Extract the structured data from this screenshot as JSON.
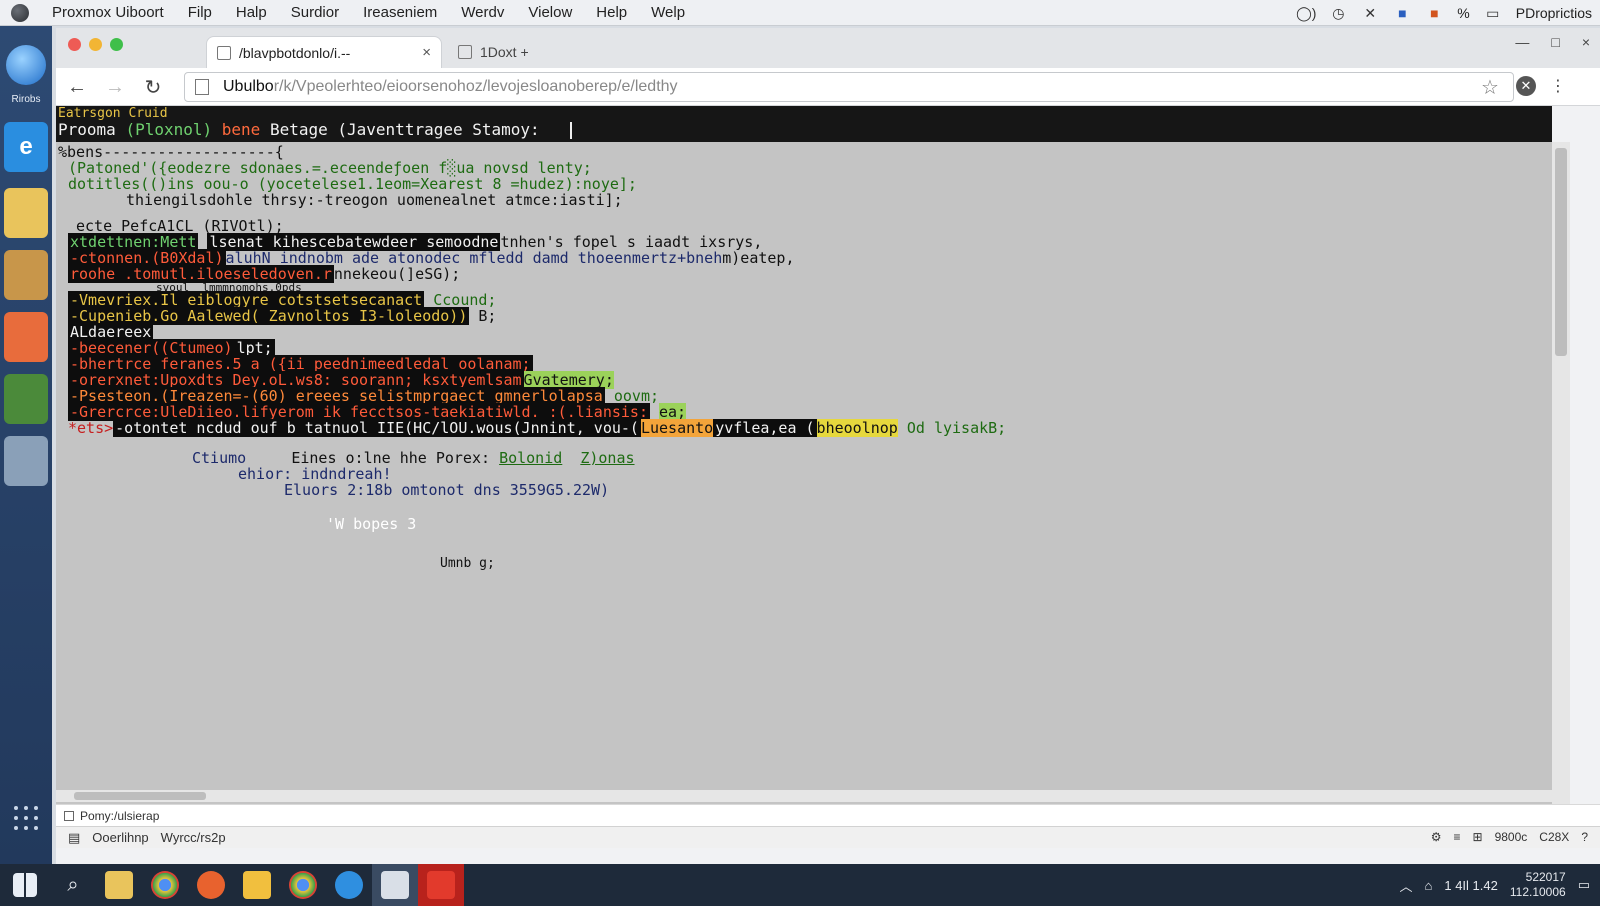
{
  "menubar": {
    "items": [
      "Proxmox Uiboort",
      "Filp",
      "Halp",
      "Surdior",
      "Ireaseniem",
      "Werdv",
      "Vielow",
      "Help",
      "Welp"
    ],
    "tray_text": "PDroprictios",
    "tray_percent": "%"
  },
  "dock": {
    "label_top": "Rirobs"
  },
  "browser": {
    "tabs": [
      {
        "label": "/blavpbotdonlo/i.--",
        "close": "×"
      },
      {
        "label": "1Doxt +"
      }
    ],
    "url_host": "Ubulbo",
    "url_path": "r/k/Vpeolerhteo/eioorsenohoz/levojesloanoberep/e/ledthy",
    "window_controls": [
      "—",
      "□",
      "×"
    ]
  },
  "terminal": {
    "header_small": "Eatrsgon Cruid",
    "prompt_main": "Prooma",
    "prompt_paren": "(Ploxnol)",
    "prompt_kw": "bene",
    "prompt_rest": "Betage (Javenttragee Stamoy:",
    "lines": {
      "l0": "%bens-------------------{",
      "l1": "(Patoned'({eodezre sdonaes.=.eceendeƒoen f░ua novsd lenty;",
      "l2": "dotitles(()ins oou-o (yocetelese1.1eom=Xearest 8 =hudez):noye];",
      "l3": "thiengilsdohle thrsy:-treogon uomenealnet atmce:iasti];",
      "l4": "ecte PefcA1CL (RIVOtl);",
      "l5a": "xtdettnen:Mett",
      "l5b": "lsenat kihescebatewdeer semoodne",
      "l5c": "tnhen's fopel s iaadt ixsrys,",
      "l6a": "-ctonnen.(B0Xdal)",
      "l6b": "aluhN indnobm ade atonodec mfledd damd thoeenmertz+bneh",
      "l6c": "m)eatep,",
      "l7a": "roohe .tomutl.iloeseledoven.r",
      "l7b": "nnekeou(]eSG);",
      "l7c": "svoul  lmmmnomohs.0pds",
      "l8a": "-Vmevriex.Il eiblogyre cotstsetsecanact",
      "l8b": "Ccound;",
      "l9a": "-Cupenieb.Go Aalewed( Zavnoltos I3-loleodo))",
      "l9b": "B;",
      "l10": "ALdaereex",
      "l11a": "-beecener((Ctumeo)",
      "l11b": "lpt;",
      "l12": "-bhertrce feranes.5 a ({ii peednimeedledal oolanam;",
      "l13a": "-orerxnet:Upoxdts Dey.oL.ws8: soorann; ksxtyemlsam",
      "l13b": "Gvatemery;",
      "l14a": "-Psesteon.(Ireazen=-(60) ereees selistmprgaect gmnerlolapsa",
      "l14b": "oovm;",
      "l15a": "-Grercrce:UleDiieo.lifyerom ik fecctsos-taekiatiwld. :(.liansis:",
      "l15b": "ea;",
      "l16a": "*ets>",
      "l16b": "-otontet ncdud ouf b tatnuol IIE(HC/lOU.wous(Jnnint, vou-(",
      "l16c": "Luesanto",
      "l16d": "yvflea,ea (",
      "l16e": "bheoolnop",
      "l16f": "Od lyisakB;",
      "l17a": "Ctiumo",
      "l17b": "Eines o:lne hhe Porex:",
      "l17c": "Bolonid",
      "l17d": "Z)onas",
      "l18": "ehior: indndreah!",
      "l19": "Eluors 2:18b omtonot dns 3559G5.22W)",
      "l20": "'W bopes 3",
      "l21": "Umnb g;"
    }
  },
  "statusline": {
    "text": "Pomy:/ulsierap"
  },
  "bottombar": {
    "items": [
      "Ooerlihnp",
      "Wyrcc/rs2p"
    ],
    "right": [
      "9800c",
      "C28X"
    ]
  },
  "taskbar": {
    "clock_time": "522017",
    "clock_date": "112.10006",
    "tray_text": "1 4Il 1.42"
  }
}
